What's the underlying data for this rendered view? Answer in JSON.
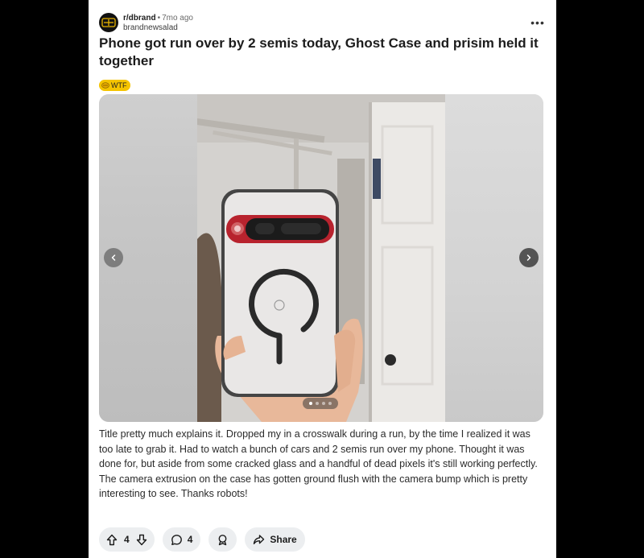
{
  "post": {
    "subreddit": "r/dbrand",
    "separator": "•",
    "time_ago": "7mo ago",
    "author": "brandnewsalad",
    "avatar_text": "db",
    "more_label": "•••",
    "title": "Phone got run over by 2 semis today, Ghost Case and prisim held it together",
    "flair": "WTF",
    "body": "Title pretty much explains it. Dropped my in a crosswalk during a run, by the time I realized it was too late to grab it. Had to watch a bunch of cars and 2 semis run over my phone. Thought it was done for, but aside from some cracked glass and a handful of dead pixels it's still working perfectly. The camera extrusion on the case has gotten ground flush with the camera bump which is pretty interesting to see. Thanks robots!"
  },
  "gallery": {
    "total_images": 4,
    "current_index": 1
  },
  "actions": {
    "vote_count": "4",
    "comment_count": "4",
    "share_label": "Share"
  },
  "colors": {
    "page_background": "#000000",
    "card_background": "#ffffff",
    "flair_background": "#f5c400",
    "pill_background": "#eceef0",
    "text_primary": "#1c1c1c"
  },
  "icons": {
    "avatar": "dbrand-logo-icon",
    "more": "more-options-icon",
    "flair": "emoji-icon",
    "prev": "chevron-left-icon",
    "next": "chevron-right-icon",
    "upvote": "upvote-arrow-icon",
    "downvote": "downvote-arrow-icon",
    "comment": "comment-bubble-icon",
    "award": "award-icon",
    "share": "share-arrow-icon"
  }
}
